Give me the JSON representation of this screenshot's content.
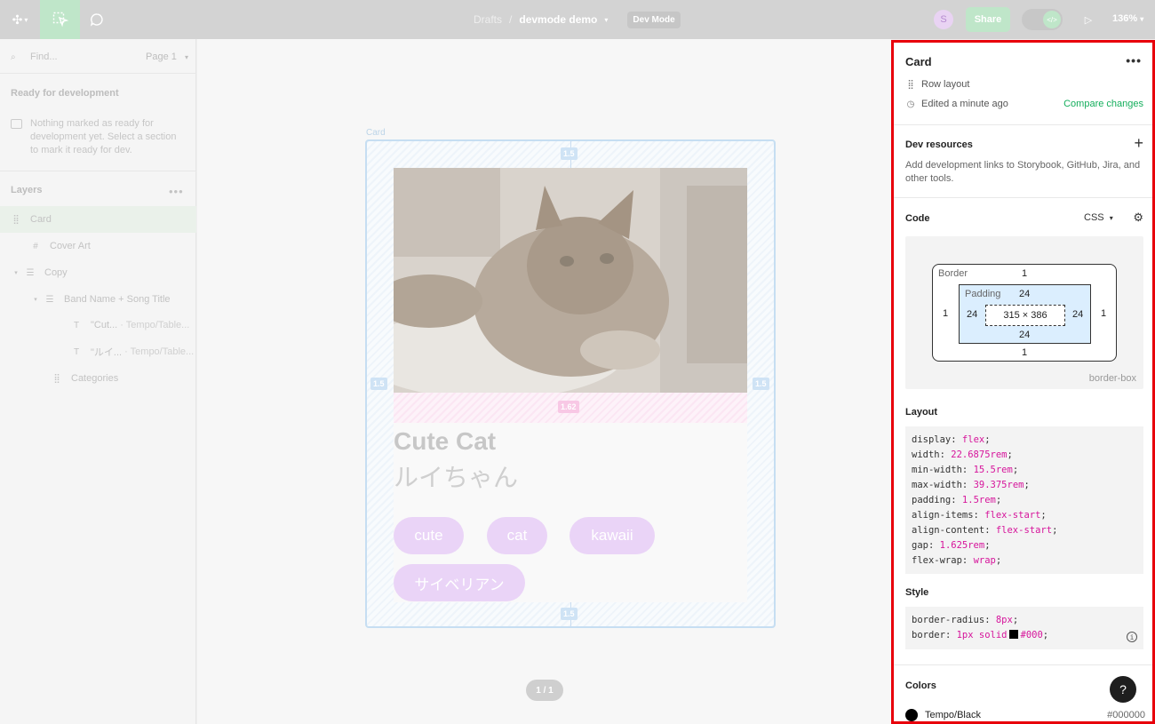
{
  "topbar": {
    "breadcrumb_project": "Drafts",
    "breadcrumb_sep": "/",
    "file_name": "devmode demo",
    "mode_badge": "Dev Mode",
    "avatar_initial": "S",
    "share_label": "Share",
    "zoom": "136%"
  },
  "left": {
    "find_placeholder": "Find...",
    "page_label": "Page 1",
    "ready_title": "Ready for development",
    "ready_note": "Nothing marked as ready for development yet. Select a section to mark it ready for dev.",
    "layers_title": "Layers",
    "layers": [
      {
        "name": "Card",
        "sub": ""
      },
      {
        "name": "Cover Art",
        "sub": ""
      },
      {
        "name": "Copy",
        "sub": ""
      },
      {
        "name": "Band Name + Song Title",
        "sub": ""
      },
      {
        "name": "\"Cut...",
        "sub": "· Tempo/Table..."
      },
      {
        "name": "\"ルイ...",
        "sub": "· Tempo/Table..."
      },
      {
        "name": "Categories",
        "sub": ""
      }
    ]
  },
  "canvas": {
    "frame_label": "Card",
    "title": "Cute Cat",
    "subtitle": "ルイちゃん",
    "tags": [
      "cute",
      "cat",
      "kawaii",
      "サイベリアン"
    ],
    "measure_padding": "1.5",
    "measure_gap": "1.62",
    "page_badge": "1 / 1"
  },
  "inspect": {
    "name": "Card",
    "layout_type": "Row layout",
    "edited": "Edited a minute ago",
    "compare": "Compare changes",
    "dev_resources_title": "Dev resources",
    "dev_resources_text": "Add development links to Storybook, GitHub, Jira, and other tools.",
    "code_title": "Code",
    "code_lang": "CSS",
    "box": {
      "border_label": "Border",
      "padding_label": "Padding",
      "radius_tl": "8",
      "radius_tr": "8",
      "radius_bl": "8",
      "radius_br": "8",
      "border_top": "1",
      "border_bottom": "1",
      "border_left": "1",
      "border_right": "1",
      "pad_top": "24",
      "pad_bottom": "24",
      "pad_left": "24",
      "pad_right": "24",
      "content": "315 × 386",
      "box_sizing": "border-box"
    },
    "layout_title": "Layout",
    "layout_css": [
      {
        "prop": "display",
        "val": "flex"
      },
      {
        "prop": "width",
        "val": "22.6875rem"
      },
      {
        "prop": "min-width",
        "val": "15.5rem"
      },
      {
        "prop": "max-width",
        "val": "39.375rem"
      },
      {
        "prop": "padding",
        "val": "1.5rem"
      },
      {
        "prop": "align-items",
        "val": "flex-start"
      },
      {
        "prop": "align-content",
        "val": "flex-start"
      },
      {
        "prop": "gap",
        "val": "1.625rem"
      },
      {
        "prop": "flex-wrap",
        "val": "wrap"
      }
    ],
    "style_title": "Style",
    "style_css": [
      {
        "prop": "border-radius",
        "val": "8px"
      },
      {
        "prop": "border",
        "val": "1px solid",
        "color": "#000"
      }
    ],
    "colors_title": "Colors",
    "color_name": "Tempo/Black",
    "color_hex": "#000000"
  },
  "theme": {
    "accent_green": "#14ae5c",
    "highlight_red": "#e8000b",
    "css_value": "#d6149b"
  }
}
